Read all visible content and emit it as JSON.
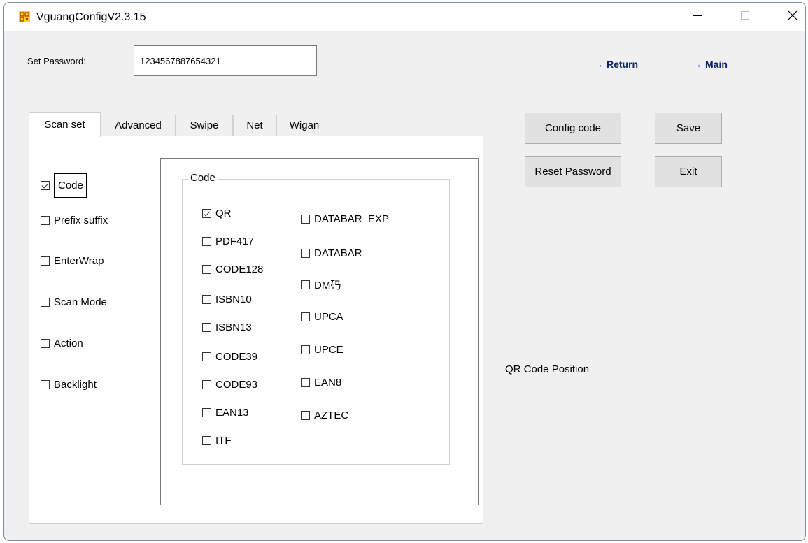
{
  "window": {
    "title": "VguangConfigV2.3.15",
    "controls": {
      "minimize": "—",
      "maximize": "☐",
      "close": "✕"
    }
  },
  "password": {
    "label": "Set Password:",
    "value": "1234567887654321"
  },
  "nav": {
    "return_label": "Return",
    "main_label": "Main",
    "arrow": "→"
  },
  "tabs": [
    {
      "label": "Scan set",
      "active": true
    },
    {
      "label": "Advanced",
      "active": false
    },
    {
      "label": "Swipe",
      "active": false
    },
    {
      "label": "Net",
      "active": false
    },
    {
      "label": "Wigan",
      "active": false
    }
  ],
  "scan_options": [
    {
      "label": "Code",
      "checked": true
    },
    {
      "label": "Prefix suffix",
      "checked": false
    },
    {
      "label": "EnterWrap",
      "checked": false
    },
    {
      "label": "Scan Mode",
      "checked": false
    },
    {
      "label": "Action",
      "checked": false
    },
    {
      "label": "Backlight",
      "checked": false
    }
  ],
  "code_group": {
    "title": "Code",
    "left_column": [
      {
        "label": "QR",
        "checked": true
      },
      {
        "label": "PDF417",
        "checked": false
      },
      {
        "label": "CODE128",
        "checked": false
      },
      {
        "label": "ISBN10",
        "checked": false
      },
      {
        "label": "ISBN13",
        "checked": false
      },
      {
        "label": "CODE39",
        "checked": false
      },
      {
        "label": "CODE93",
        "checked": false
      },
      {
        "label": "EAN13",
        "checked": false
      },
      {
        "label": "ITF",
        "checked": false
      }
    ],
    "right_column": [
      {
        "label": "DATABAR_EXP",
        "checked": false
      },
      {
        "label": "DATABAR",
        "checked": false
      },
      {
        "label": "DM码",
        "checked": false
      },
      {
        "label": "UPCA",
        "checked": false
      },
      {
        "label": "UPCE",
        "checked": false
      },
      {
        "label": "EAN8",
        "checked": false
      },
      {
        "label": "AZTEC",
        "checked": false
      }
    ]
  },
  "buttons": {
    "config_code": "Config code",
    "reset_password": "Reset Password",
    "save": "Save",
    "exit": "Exit"
  },
  "qr_position_label": "QR Code Position",
  "colors": {
    "accent": "#1e7be0",
    "link_text": "#0a246a",
    "icon_yellow": "#f5d800"
  }
}
